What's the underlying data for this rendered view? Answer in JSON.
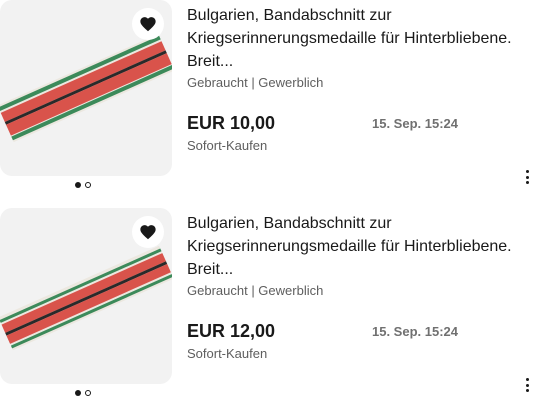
{
  "colors": {
    "text_primary": "#191919",
    "text_secondary": "#5e5e5e",
    "time_text": "#707070",
    "thumb_background": "#f2f2f2",
    "ribbon_red": "#d9534b",
    "ribbon_green": "#3c8a5a",
    "ribbon_black": "#2a2a2a"
  },
  "listings": [
    {
      "title": "Bulgarien, Bandabschnitt zur Kriegserinnerungsmedaille für Hinterbliebene. Breit...",
      "condition": "Gebraucht | Gewerblich",
      "price": "EUR 10,00",
      "end_time": "15. Sep. 15:24",
      "buy_format": "Sofort-Kaufen",
      "image_dots": {
        "count": 2,
        "active_index": 0
      },
      "watch_icon": "heart-icon",
      "menu_icon": "more-vertical-icon"
    },
    {
      "title": "Bulgarien, Bandabschnitt zur Kriegserinnerungsmedaille für Hinterbliebene. Breit...",
      "condition": "Gebraucht | Gewerblich",
      "price": "EUR 12,00",
      "end_time": "15. Sep. 15:24",
      "buy_format": "Sofort-Kaufen",
      "image_dots": {
        "count": 2,
        "active_index": 0
      },
      "watch_icon": "heart-icon",
      "menu_icon": "more-vertical-icon"
    }
  ]
}
